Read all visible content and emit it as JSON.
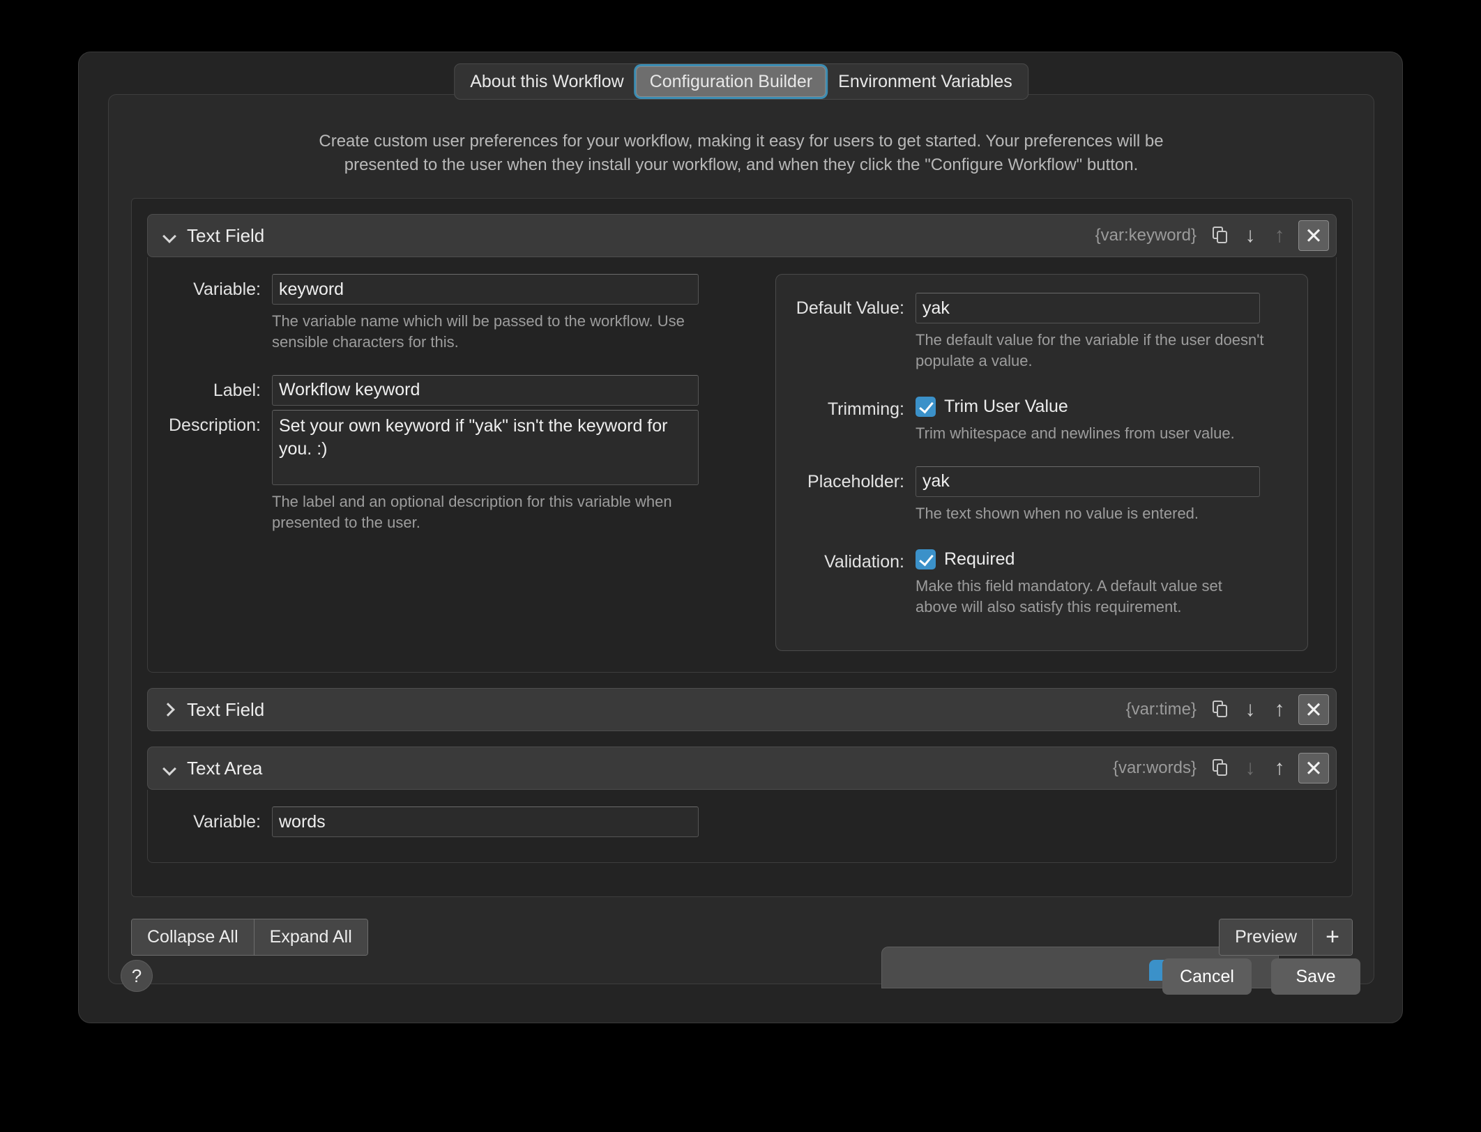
{
  "tabs": [
    {
      "label": "About this Workflow",
      "active": false
    },
    {
      "label": "Configuration Builder",
      "active": true
    },
    {
      "label": "Environment Variables",
      "active": false
    }
  ],
  "intro": "Create custom user preferences for your workflow, making it easy for users to get started. Your preferences will be presented to the user when they install your workflow, and when they click the \"Configure Workflow\" button.",
  "accent_color": "#3b91c9",
  "focus_ring_color": "#3c8db3",
  "cards": [
    {
      "title": "Text Field",
      "var_tag": "{var:keyword}",
      "expanded": true,
      "left": {
        "variable_label": "Variable:",
        "variable_value": "keyword",
        "variable_hint": "The variable name which will be passed to the workflow. Use sensible characters for this.",
        "label_label": "Label:",
        "label_value": "Workflow keyword",
        "description_label": "Description:",
        "description_value": "Set your own keyword if \"yak\" isn't the keyword for you. :)",
        "description_hint": "The label and an optional description for this variable when presented to the user."
      },
      "right": {
        "default_label": "Default Value:",
        "default_value": "yak",
        "default_hint": "The default value for the variable if the user doesn't populate a value.",
        "trimming_label": "Trimming:",
        "trimming_checkbox": "Trim User Value",
        "trimming_checked": true,
        "trimming_hint": "Trim whitespace and newlines from user value.",
        "placeholder_label": "Placeholder:",
        "placeholder_value": "yak",
        "placeholder_hint": "The text shown when no value is entered.",
        "validation_label": "Validation:",
        "validation_checkbox": "Required",
        "validation_checked": true,
        "validation_hint": "Make this field mandatory. A default value set above will also satisfy this requirement."
      }
    },
    {
      "title": "Text Field",
      "var_tag": "{var:time}",
      "expanded": false
    },
    {
      "title": "Text Area",
      "var_tag": "{var:words}",
      "expanded": true,
      "left": {
        "variable_label": "Variable:",
        "variable_value": "words"
      }
    }
  ],
  "toolbar": {
    "collapse_all": "Collapse All",
    "expand_all": "Expand All",
    "preview": "Preview",
    "add": "+"
  },
  "footer": {
    "help": "?",
    "cancel": "Cancel",
    "save": "Save"
  }
}
